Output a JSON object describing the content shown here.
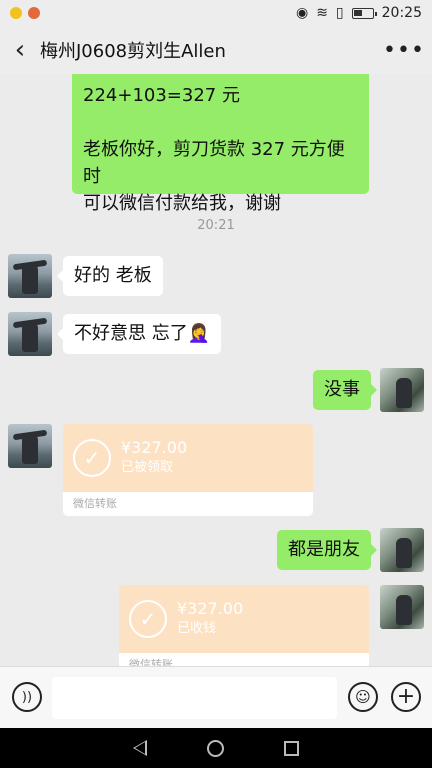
{
  "status": {
    "time": "20:25"
  },
  "header": {
    "title": "梅州J0608剪刘生Allen",
    "back_icon": "chevron-left-icon",
    "more_icon": "ellipsis-icon"
  },
  "messages": {
    "first_out_line1": "224+103=327 元",
    "first_out_line2": "老板你好，剪刀货款 327 元方便时",
    "first_out_line3": "可以微信付款给我，谢谢",
    "timestamp": "20:21",
    "in1": "好的 老板",
    "in2_text": "不好意思 忘了",
    "in2_emoji": "🤦‍♀️",
    "out1": "没事",
    "transfer_in": {
      "amount": "¥327.00",
      "status": "已被领取",
      "label": "微信转账"
    },
    "out2": "都是朋友",
    "transfer_out": {
      "amount": "¥327.00",
      "status": "已收钱",
      "label": "微信转账"
    }
  },
  "colors": {
    "out_bubble": "#95ec69",
    "transfer_bg": "#fde1c3",
    "chat_bg": "#ebebeb"
  }
}
